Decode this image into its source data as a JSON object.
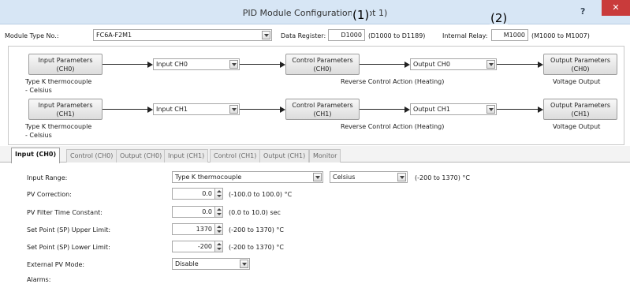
{
  "window": {
    "title": "PID Module Configuration (Slot 1)",
    "help": "?",
    "close": "✕"
  },
  "callouts": {
    "one": "(1)",
    "two": "(2)"
  },
  "header": {
    "module_type_label": "Module Type No.:",
    "module_type_value": "FC6A-F2M1",
    "data_register_label": "Data Register:",
    "data_register_value": "D1000",
    "data_register_range": "(D1000 to D1189)",
    "internal_relay_label": "Internal Relay:",
    "internal_relay_value": "M1000",
    "internal_relay_range": "(M1000 to M1007)"
  },
  "flow": [
    {
      "input_params_l1": "Input Parameters",
      "input_params_l2": "(CH0)",
      "input_select": "Input CH0",
      "control_params_l1": "Control Parameters",
      "control_params_l2": "(CH0)",
      "output_select": "Output CH0",
      "output_params_l1": "Output Parameters",
      "output_params_l2": "(CH0)",
      "input_desc_l1": "Type K thermocouple",
      "input_desc_l2": "- Celsius",
      "control_desc": "Reverse Control Action (Heating)",
      "output_desc": "Voltage Output"
    },
    {
      "input_params_l1": "Input Parameters",
      "input_params_l2": "(CH1)",
      "input_select": "Input CH1",
      "control_params_l1": "Control Parameters",
      "control_params_l2": "(CH1)",
      "output_select": "Output CH1",
      "output_params_l1": "Output Parameters",
      "output_params_l2": "(CH1)",
      "input_desc_l1": "Type K thermocouple",
      "input_desc_l2": "- Celsius",
      "control_desc": "Reverse Control Action (Heating)",
      "output_desc": "Voltage Output"
    }
  ],
  "tabs": [
    "Input (CH0)",
    "Control (CH0)",
    "Output (CH0)",
    "Input (CH1)",
    "Control (CH1)",
    "Output (CH1)",
    "Monitor"
  ],
  "form": {
    "input_range_label": "Input Range:",
    "input_range_value": "Type K thermocouple",
    "unit_value": "Celsius",
    "input_range_hint": "(-200 to 1370) °C",
    "pv_correction_label": "PV Correction:",
    "pv_correction_value": "0.0",
    "pv_correction_hint": "(-100.0 to 100.0) °C",
    "pv_filter_label": "PV Filter Time Constant:",
    "pv_filter_value": "0.0",
    "pv_filter_hint": "(0.0 to 10.0) sec",
    "sp_upper_label": "Set Point (SP) Upper Limit:",
    "sp_upper_value": "1370",
    "sp_upper_hint": "(-200 to 1370) °C",
    "sp_lower_label": "Set Point (SP) Lower Limit:",
    "sp_lower_value": "-200",
    "sp_lower_hint": "(-200 to 1370) °C",
    "ext_pv_label": "External PV Mode:",
    "ext_pv_value": "Disable",
    "alarms_label": "Alarms:"
  },
  "colors": {
    "titlebar": "#d7e6f5",
    "close": "#c93b3b",
    "active_tab_text": "#111111"
  }
}
